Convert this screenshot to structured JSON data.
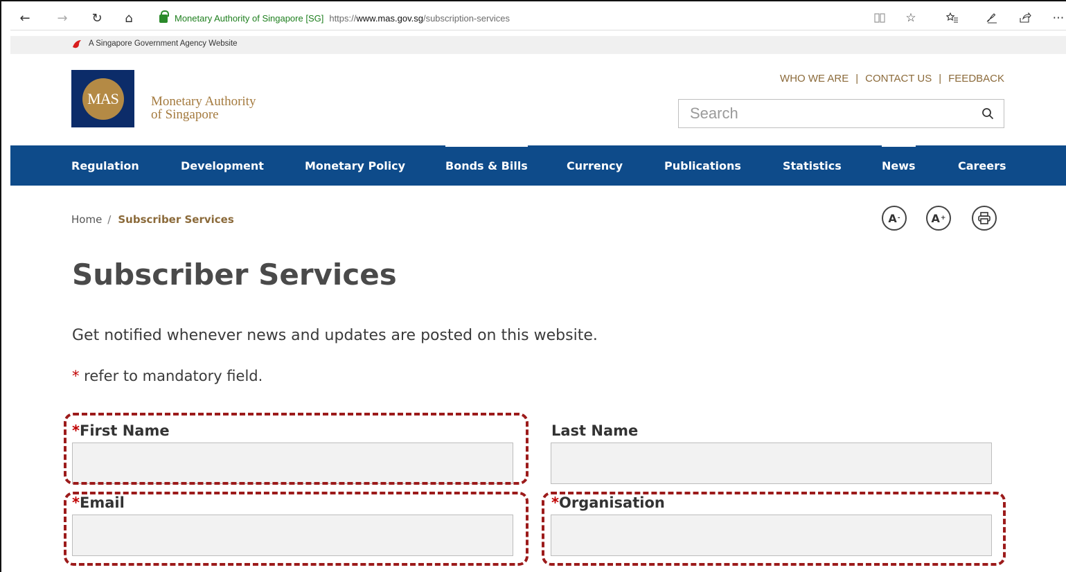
{
  "browser": {
    "site_identity": "Monetary Authority of Singapore [SG]",
    "url_scheme": "https://",
    "url_host": "www.mas.gov.sg",
    "url_path": "/subscription-services",
    "icons": [
      "back-icon",
      "forward-icon",
      "refresh-icon",
      "home-icon",
      "lock-icon",
      "reading-view-icon",
      "favorite-star-icon",
      "favorites-hub-icon",
      "pen-icon",
      "share-icon",
      "more-icon"
    ]
  },
  "gov_banner": {
    "text": "A Singapore Government Agency Website"
  },
  "header": {
    "logo_mark": "MAS",
    "logo_name_line1": "Monetary Authority",
    "logo_name_line2": "of Singapore",
    "top_links": [
      "WHO WE ARE",
      "CONTACT US",
      "FEEDBACK"
    ],
    "separator": "|",
    "search_placeholder": "Search"
  },
  "nav": {
    "items": [
      {
        "label": "Regulation",
        "active": false
      },
      {
        "label": "Development",
        "active": false
      },
      {
        "label": "Monetary Policy",
        "active": false
      },
      {
        "label": "Bonds & Bills",
        "active": true
      },
      {
        "label": "Currency",
        "active": false
      },
      {
        "label": "Publications",
        "active": false
      },
      {
        "label": "Statistics",
        "active": false
      },
      {
        "label": "News",
        "active": true
      },
      {
        "label": "Careers",
        "active": false
      }
    ],
    "color": "#0e4b8a"
  },
  "breadcrumb": {
    "home": "Home",
    "separator": "/",
    "current": "Subscriber Services"
  },
  "page_tools": {
    "decrease_font": "A",
    "decrease_symbol": "-",
    "increase_font": "A",
    "increase_symbol": "+"
  },
  "main": {
    "title": "Subscriber Services",
    "intro": "Get notified whenever news and updates are posted on this website.",
    "mandatory_star": "*",
    "mandatory_note": " refer to mandatory field."
  },
  "form": {
    "first_name": {
      "required": "*",
      "label": "First Name",
      "value": ""
    },
    "last_name": {
      "required": "",
      "label": "Last Name",
      "value": ""
    },
    "email": {
      "required": "*",
      "label": "Email",
      "value": ""
    },
    "organisation": {
      "required": "*",
      "label": "Organisation",
      "value": ""
    }
  },
  "colors": {
    "accent_gold": "#8b6a3a",
    "required_red": "#c00000",
    "highlight": "#9c1b1b"
  }
}
